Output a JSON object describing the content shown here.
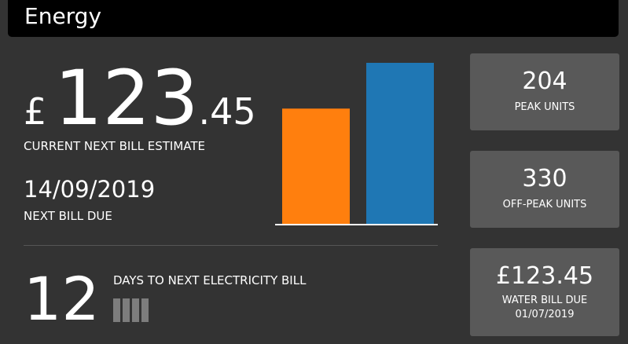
{
  "header": {
    "title": "Energy"
  },
  "bill": {
    "currency": "£",
    "amount_major": "123",
    "amount_minor": ".45",
    "label": "CURRENT NEXT BILL ESTIMATE"
  },
  "due": {
    "date": "14/09/2019",
    "label": "NEXT BILL DUE"
  },
  "countdown": {
    "days": "12",
    "label": "DAYS TO NEXT ELECTRICITY BILL",
    "progress_segments": 4
  },
  "peak": {
    "value": "204",
    "label": "PEAK UNITS"
  },
  "offpeak": {
    "value": "330",
    "label": "OFF-PEAK UNITS"
  },
  "water": {
    "amount": "£123.45",
    "label": "WATER BILL DUE",
    "date": "01/07/2019"
  },
  "chart_data": {
    "type": "bar",
    "categories": [
      "",
      ""
    ],
    "values": [
      204,
      285
    ],
    "colors": [
      "#ff7f0e",
      "#1f77b4"
    ],
    "ylim": [
      0,
      285
    ],
    "grid": false,
    "title": "",
    "xlabel": "",
    "ylabel": ""
  }
}
